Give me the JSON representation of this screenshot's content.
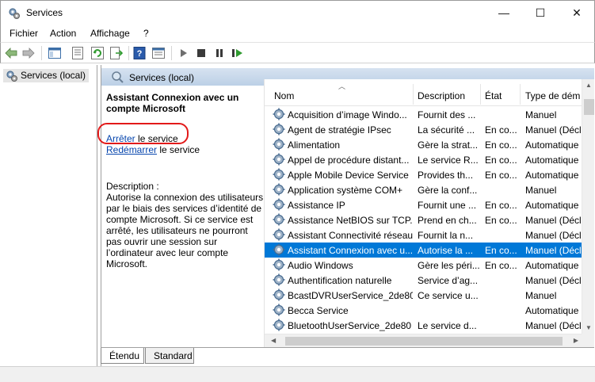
{
  "window": {
    "title": "Services",
    "min_label": "—",
    "max_label": "☐",
    "close_label": "✕"
  },
  "menu": [
    "Fichier",
    "Action",
    "Affichage",
    "?"
  ],
  "toolbar": {
    "icons": [
      "back-arrow-icon",
      "forward-arrow-icon",
      "show-hide-console-tree-icon",
      "properties-icon",
      "refresh-icon",
      "export-list-icon",
      "help-icon",
      "view-icon",
      "start-service-icon",
      "stop-service-icon",
      "pause-service-icon",
      "restart-service-icon"
    ]
  },
  "tree": {
    "root_label": "Services (local)"
  },
  "main": {
    "header_label": "Services (local)"
  },
  "details": {
    "service_title": "Assistant Connexion avec un compte Microsoft",
    "stop_link": "Arrêter",
    "stop_suffix": " le service",
    "restart_link": "Redémarrer",
    "restart_suffix": " le service",
    "description_label": "Description :",
    "description_text": "Autorise la connexion des utilisateurs par le biais des services d’identité de compte Microsoft. Si ce service est arrêté, les utilisateurs ne pourront pas ouvrir une session sur l’ordinateur avec leur compte Microsoft."
  },
  "table": {
    "columns": [
      "Nom",
      "Description",
      "État",
      "Type de dém"
    ],
    "rows": [
      {
        "name": "Acquisition d’image Windo...",
        "description": "Fournit des ...",
        "state": "",
        "type": "Manuel"
      },
      {
        "name": "Agent de stratégie IPsec",
        "description": "La sécurité ...",
        "state": "En co...",
        "type": "Manuel (Décl"
      },
      {
        "name": "Alimentation",
        "description": "Gère la strat...",
        "state": "En co...",
        "type": "Automatique"
      },
      {
        "name": "Appel de procédure distant...",
        "description": "Le service R...",
        "state": "En co...",
        "type": "Automatique"
      },
      {
        "name": "Apple Mobile Device Service",
        "description": "Provides th...",
        "state": "En co...",
        "type": "Automatique"
      },
      {
        "name": "Application système COM+",
        "description": "Gère la conf...",
        "state": "",
        "type": "Manuel"
      },
      {
        "name": "Assistance IP",
        "description": "Fournit une ...",
        "state": "En co...",
        "type": "Automatique"
      },
      {
        "name": "Assistance NetBIOS sur TCP...",
        "description": "Prend en ch...",
        "state": "En co...",
        "type": "Manuel (Décl"
      },
      {
        "name": "Assistant Connectivité réseau",
        "description": "Fournit la n...",
        "state": "",
        "type": "Manuel (Décl"
      },
      {
        "name": "Assistant Connexion avec u...",
        "description": "Autorise la ...",
        "state": "En co...",
        "type": "Manuel (Décl"
      },
      {
        "name": "Audio Windows",
        "description": "Gère les péri...",
        "state": "En co...",
        "type": "Automatique"
      },
      {
        "name": "Authentification naturelle",
        "description": "Service d’ag...",
        "state": "",
        "type": "Manuel (Décl"
      },
      {
        "name": "BcastDVRUserService_2de80",
        "description": "Ce service u...",
        "state": "",
        "type": "Manuel"
      },
      {
        "name": "Becca Service",
        "description": "",
        "state": "",
        "type": "Automatique"
      },
      {
        "name": "BluetoothUserService_2de80",
        "description": "Le service d...",
        "state": "",
        "type": "Manuel (Décl"
      }
    ],
    "selected_index": 9
  },
  "tabs": {
    "extended": "Étendu",
    "standard": "Standard"
  },
  "colors": {
    "selection": "#0078d7",
    "highlight_oval": "#e21a1a",
    "link": "#0645ad"
  }
}
